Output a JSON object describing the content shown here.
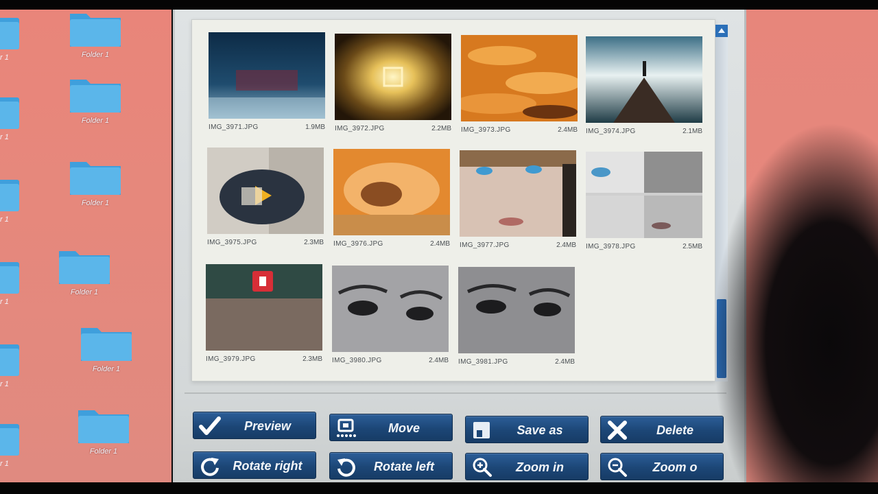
{
  "desktop": {
    "folders": [
      {
        "label": "Folder 1"
      },
      {
        "label": "Folder 1"
      },
      {
        "label": "Folder 1"
      },
      {
        "label": "Folder 1"
      },
      {
        "label": "Folder 1"
      },
      {
        "label": "Folder 1"
      }
    ],
    "cut_labels": [
      "r 1",
      "r 1",
      "r 1",
      "r 1",
      "r 1",
      "r 1"
    ],
    "colors": {
      "wallpaper": "#e6887c",
      "folder": "#4aa8e0"
    }
  },
  "gallery": {
    "items": [
      {
        "name": "IMG_3971.JPG",
        "size": "1.9MB"
      },
      {
        "name": "IMG_3972.JPG",
        "size": "2.2MB"
      },
      {
        "name": "IMG_3973.JPG",
        "size": "2.4MB"
      },
      {
        "name": "IMG_3974.JPG",
        "size": "2.1MB"
      },
      {
        "name": "IMG_3975.JPG",
        "size": "2.3MB"
      },
      {
        "name": "IMG_3976.JPG",
        "size": "2.4MB"
      },
      {
        "name": "IMG_3977.JPG",
        "size": "2.4MB"
      },
      {
        "name": "IMG_3978.JPG",
        "size": "2.5MB"
      },
      {
        "name": "IMG_3979.JPG",
        "size": "2.3MB"
      },
      {
        "name": "IMG_3980.JPG",
        "size": "2.4MB"
      },
      {
        "name": "IMG_3981.JPG",
        "size": "2.4MB"
      }
    ]
  },
  "toolbar": {
    "preview": "Preview",
    "move": "Move",
    "save_as": "Save as",
    "delete": "Delete",
    "rotate_right": "Rotate right",
    "rotate_left": "Rotate left",
    "zoom_in": "Zoom in",
    "zoom_out": "Zoom o",
    "colors": {
      "button": "#1f4a7b",
      "text": "#f2f5f8"
    }
  }
}
